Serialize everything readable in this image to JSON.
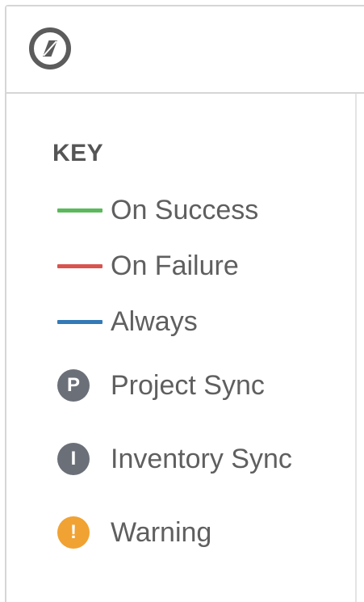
{
  "toolbar": {
    "compass_icon": "compass-icon"
  },
  "key": {
    "title": "KEY",
    "lines": [
      {
        "label": "On Success",
        "color": "#5cb85c"
      },
      {
        "label": "On Failure",
        "color": "#d9534f"
      },
      {
        "label": "Always",
        "color": "#337ab7"
      }
    ],
    "badges": [
      {
        "letter": "P",
        "label": "Project Sync",
        "color": "#6b6f78"
      },
      {
        "letter": "I",
        "label": "Inventory Sync",
        "color": "#6b6f78"
      },
      {
        "letter": "!",
        "label": "Warning",
        "color": "#f0a233"
      }
    ]
  }
}
